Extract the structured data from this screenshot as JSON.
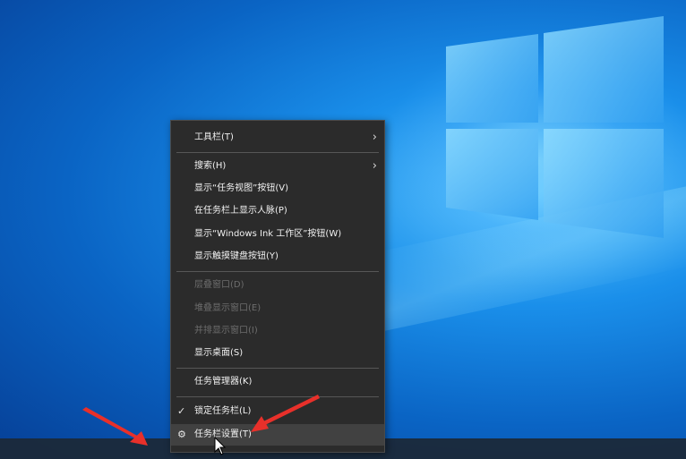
{
  "desktop": {
    "background": "windows-10-blue-wallpaper",
    "logo": "windows-logo"
  },
  "context_menu": {
    "items": [
      {
        "label": "工具栏(T)",
        "submenu": true
      },
      {
        "label": "搜索(H)",
        "submenu": true
      },
      {
        "label": "显示“任务视图”按钮(V)"
      },
      {
        "label": "在任务栏上显示人脉(P)"
      },
      {
        "label": "显示“Windows Ink 工作区”按钮(W)"
      },
      {
        "label": "显示触摸键盘按钮(Y)"
      },
      {
        "label": "层叠窗口(D)",
        "disabled": true
      },
      {
        "label": "堆叠显示窗口(E)",
        "disabled": true
      },
      {
        "label": "并排显示窗口(I)",
        "disabled": true
      },
      {
        "label": "显示桌面(S)"
      },
      {
        "label": "任务管理器(K)"
      },
      {
        "label": "锁定任务栏(L)",
        "checked": true
      },
      {
        "label": "任务栏设置(T)",
        "icon": "gear-icon",
        "highlighted": true
      }
    ],
    "check_glyph": "✓",
    "gear_glyph": "⚙",
    "chevron_glyph": "›"
  },
  "colors": {
    "menu_bg": "#2b2b2b",
    "menu_text": "#f2f2f2",
    "disabled_text": "#6d6d6d",
    "arrow": "#e8302a"
  }
}
